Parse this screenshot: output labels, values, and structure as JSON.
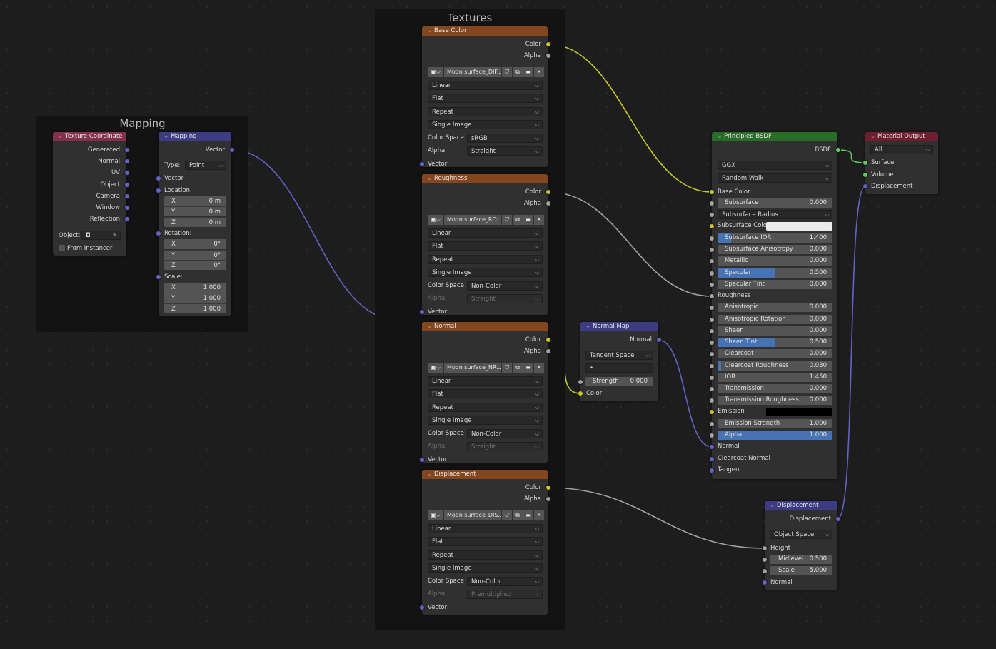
{
  "frames": {
    "mapping": "Mapping",
    "textures": "Textures"
  },
  "texcoord": {
    "title": "Texture Coordinate",
    "outputs": [
      "Generated",
      "Normal",
      "UV",
      "Object",
      "Camera",
      "Window",
      "Reflection"
    ],
    "object_label": "Object:",
    "from_instancer": "From Instancer"
  },
  "mapping": {
    "title": "Mapping",
    "out": "Vector",
    "type_label": "Type:",
    "type_value": "Point",
    "in_vector": "Vector",
    "location_label": "Location:",
    "location": [
      {
        "a": "X",
        "v": "0 m"
      },
      {
        "a": "Y",
        "v": "0 m"
      },
      {
        "a": "Z",
        "v": "0 m"
      }
    ],
    "rotation_label": "Rotation:",
    "rotation": [
      {
        "a": "X",
        "v": "0°"
      },
      {
        "a": "Y",
        "v": "0°"
      },
      {
        "a": "Z",
        "v": "0°"
      }
    ],
    "scale_label": "Scale:",
    "scale": [
      {
        "a": "X",
        "v": "1.000"
      },
      {
        "a": "Y",
        "v": "1.000"
      },
      {
        "a": "Z",
        "v": "1.000"
      }
    ]
  },
  "textures": [
    {
      "title": "Base Color",
      "image": "Moon surface_DIF...",
      "interp": "Linear",
      "proj": "Flat",
      "ext": "Repeat",
      "src": "Single Image",
      "cs_label": "Color Space",
      "cs": "sRGB",
      "alpha_label": "Alpha",
      "alpha": "Straight",
      "alpha_dim": false
    },
    {
      "title": "Roughness",
      "image": "Moon surface_RO...",
      "interp": "Linear",
      "proj": "Flat",
      "ext": "Repeat",
      "src": "Single Image",
      "cs_label": "Color Space",
      "cs": "Non-Color",
      "alpha_label": "Alpha",
      "alpha": "Straight",
      "alpha_dim": true
    },
    {
      "title": "Normal",
      "image": "Moon surface_NR...",
      "interp": "Linear",
      "proj": "Flat",
      "ext": "Repeat",
      "src": "Single Image",
      "cs_label": "Color Space",
      "cs": "Non-Color",
      "alpha_label": "Alpha",
      "alpha": "Straight",
      "alpha_dim": true
    },
    {
      "title": "Displacement",
      "image": "Moon surface_DIS...",
      "interp": "Linear",
      "proj": "Flat",
      "ext": "Repeat",
      "src": "Single Image",
      "cs_label": "Color Space",
      "cs": "Non-Color",
      "alpha_label": "Alpha",
      "alpha": "Premultiplied",
      "alpha_dim": true
    }
  ],
  "tex_sockets": {
    "color": "Color",
    "alpha": "Alpha",
    "vector": "Vector"
  },
  "normalmap": {
    "title": "Normal Map",
    "out": "Normal",
    "space": "Tangent Space",
    "uv": "•",
    "strength_label": "Strength",
    "strength": "0.000",
    "in_color": "Color"
  },
  "bsdf": {
    "title": "Principled BSDF",
    "out": "BSDF",
    "dist": "GGX",
    "sss": "Random Walk",
    "base_color": "Base Color",
    "fields": [
      {
        "l": "Subsurface",
        "v": "0.000",
        "f": 0
      },
      {
        "l": "Subsurface Radius",
        "dd": true
      },
      {
        "l": "Subsurface Colo",
        "swatch": "#ececec"
      },
      {
        "l": "Subsurface IOR",
        "v": "1.400",
        "f": 0.12
      },
      {
        "l": "Subsurface Anisotropy",
        "v": "0.000",
        "f": 0
      },
      {
        "l": "Metallic",
        "v": "0.000",
        "f": 0
      },
      {
        "l": "Specular",
        "v": "0.500",
        "f": 0.5
      },
      {
        "l": "Specular Tint",
        "v": "0.000",
        "f": 0
      },
      {
        "l": "Roughness",
        "plain": true
      },
      {
        "l": "Anisotropic",
        "v": "0.000",
        "f": 0
      },
      {
        "l": "Anisotropic Rotation",
        "v": "0.000",
        "f": 0
      },
      {
        "l": "Sheen",
        "v": "0.000",
        "f": 0
      },
      {
        "l": "Sheen Tint",
        "v": "0.500",
        "f": 0.5
      },
      {
        "l": "Clearcoat",
        "v": "0.000",
        "f": 0
      },
      {
        "l": "Clearcoat Roughness",
        "v": "0.030",
        "f": 0.03
      },
      {
        "l": "IOR",
        "v": "1.450",
        "f": 0
      },
      {
        "l": "Transmission",
        "v": "0.000",
        "f": 0
      },
      {
        "l": "Transmission Roughness",
        "v": "0.000",
        "f": 0
      },
      {
        "l": "Emission",
        "swatch": "#000000"
      },
      {
        "l": "Emission Strength",
        "v": "1.000",
        "f": 0
      },
      {
        "l": "Alpha",
        "v": "1.000",
        "f": 1
      },
      {
        "l": "Normal",
        "plain": true
      },
      {
        "l": "Clearcoat Normal",
        "plain": true
      },
      {
        "l": "Tangent",
        "plain": true
      }
    ]
  },
  "matout": {
    "title": "Material Output",
    "target": "All",
    "inputs": [
      "Surface",
      "Volume",
      "Displacement"
    ]
  },
  "disp": {
    "title": "Displacement",
    "out": "Displacement",
    "space": "Object Space",
    "height": "Height",
    "midlevel_label": "Midlevel",
    "midlevel": "0.500",
    "scale_label": "Scale",
    "scale": "5.000",
    "normal": "Normal"
  },
  "colors": {
    "texture_header": "#84461e",
    "input_header": "#83314a",
    "vector_header": "#3c3c83",
    "shader_header": "#276c27",
    "output_header": "#6e1e2e",
    "wire_color": "#c7c729",
    "wire_gray": "#a1a1a1",
    "wire_vector": "#6363c7",
    "wire_shader": "#63c763"
  }
}
